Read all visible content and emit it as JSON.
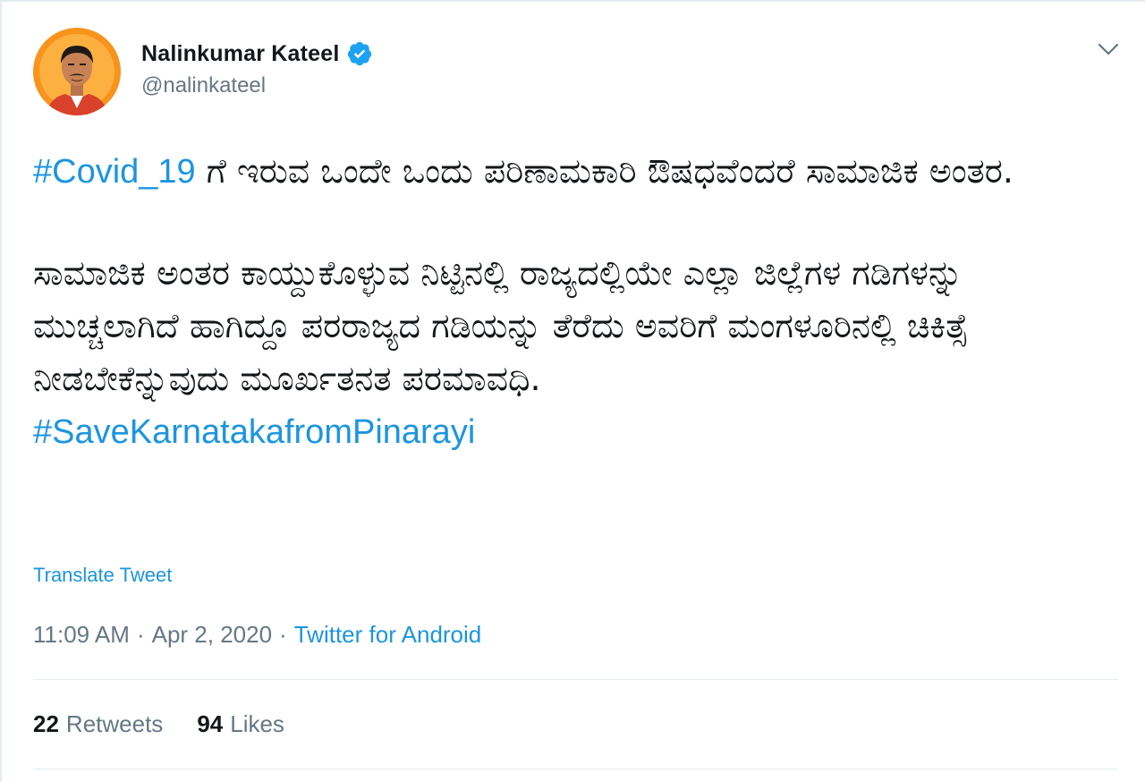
{
  "user": {
    "display_name": "Nalinkumar Kateel",
    "handle": "@nalinkateel",
    "verified": true
  },
  "tweet": {
    "paragraph1": {
      "hashtag": "#Covid_19",
      "text": " ಗೆ ಇರುವ ಒಂದೇ ಒಂದು ಪರಿಣಾಮಕಾರಿ ಔಷಧವೆಂದರೆ ಸಾಮಾಜಿಕ ಅಂತರ."
    },
    "paragraph2": {
      "text": "ಸಾಮಾಜಿಕ ಅಂತರ ಕಾಯ್ದುಕೊಳ್ಳುವ ನಿಟ್ಟಿನಲ್ಲಿ ರಾಜ್ಯದಲ್ಲಿಯೇ ಎಲ್ಲಾ ಜಿಲ್ಲೆಗಳ ಗಡಿಗಳನ್ನು ಮುಚ್ಚಲಾಗಿದೆ ಹಾಗಿದ್ದೂ ಪರರಾಜ್ಯದ ಗಡಿಯನ್ನು ತೆರೆದು ಅವರಿಗೆ ಮಂಗಳೂರಿನಲ್ಲಿ ಚಿಕಿತ್ಸೆ ನೀಡಬೇಕೆನ್ನುವುದು ಮೂರ್ಖತನತ ಪರಮಾವಧಿ.",
      "hashtag": "#SaveKarnatakafromPinarayi"
    },
    "translate_label": "Translate Tweet"
  },
  "meta": {
    "time": "11:09 AM",
    "separator": "·",
    "date": "Apr 2, 2020",
    "source": "Twitter for Android"
  },
  "stats": {
    "retweets_count": "22",
    "retweets_label": "Retweets",
    "likes_count": "94",
    "likes_label": "Likes"
  },
  "icons": {
    "verified": "verified-badge-icon",
    "caret": "chevron-down-icon"
  },
  "colors": {
    "link": "#1b95e0",
    "secondary_text": "#657786",
    "primary_text": "#14171a",
    "divider": "#e6ecf0",
    "avatar_bg": "#f7941d"
  }
}
